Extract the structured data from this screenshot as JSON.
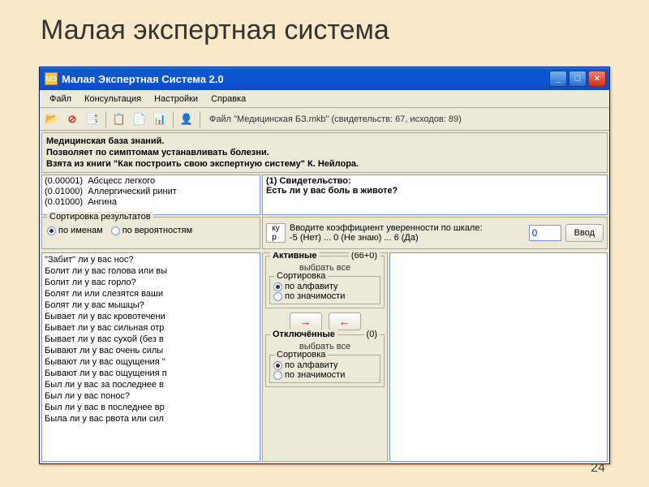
{
  "slide": {
    "title": "Малая экспертная система",
    "page": "24"
  },
  "window": {
    "title": "Малая Экспертная Система 2.0",
    "menu": [
      "Файл",
      "Консультация",
      "Настройки",
      "Справка"
    ],
    "file_label": "Файл  \"Медицинская БЗ.mkb\"  (свидетельств: 67, исходов: 89)"
  },
  "info": {
    "line1": "Медицинская база знаний.",
    "line2": "Позволяет по симптомам устанавливать болезни.",
    "line3": "Взята из книги \"Как построить свою экспертную систему\" К. Нейлора."
  },
  "results": [
    {
      "p": "(0.00001)",
      "name": "Абсцесс легкого"
    },
    {
      "p": "(0.01000)",
      "name": "Аллергический ринит"
    },
    {
      "p": "(0.01000)",
      "name": "Ангина"
    }
  ],
  "evidence": {
    "header": "(1) Свидетельство:",
    "question": "Есть ли у вас боль в животе?"
  },
  "sort_results": {
    "label": "Сортировка результатов",
    "by_name": "по именам",
    "by_prob": "по вероятностям"
  },
  "coef": {
    "prompt1": "Вводите коэффициент уверенности по шкале:",
    "prompt2": "-5 (Нет) ... 0 (Не знаю) ... 6 (Да)",
    "value": "0",
    "enter": "Ввод"
  },
  "questions": [
    "\"Забит\" ли у вас нос?",
    "Болит ли у вас голова или вы",
    "Болит ли у вас горло?",
    "Болят ли или слезятся ваши",
    "Болят ли у вас мышцы?",
    "Бывает ли у вас кровотечени",
    "Бывает ли у вас сильная отр",
    "Бывает ли у вас сухой (без в",
    "Бывают ли у вас очень силы",
    "Бывают ли у вас ощущения \"",
    "Бывают ли у вас ощущения п",
    "Был ли у вас за последнее в",
    "Был ли у вас понос?",
    "Был ли у вас в последнее вр",
    "Была ли у вас рвота или сил"
  ],
  "filter": {
    "active": {
      "label": "Активные",
      "count": "(66+0)",
      "selectall": "выбрать все"
    },
    "disabled": {
      "label": "Отключённые",
      "count": "(0)",
      "selectall": "выбрать все"
    },
    "sort_label": "Сортировка",
    "by_alpha": "по алфавиту",
    "by_signif": "по значимости"
  }
}
